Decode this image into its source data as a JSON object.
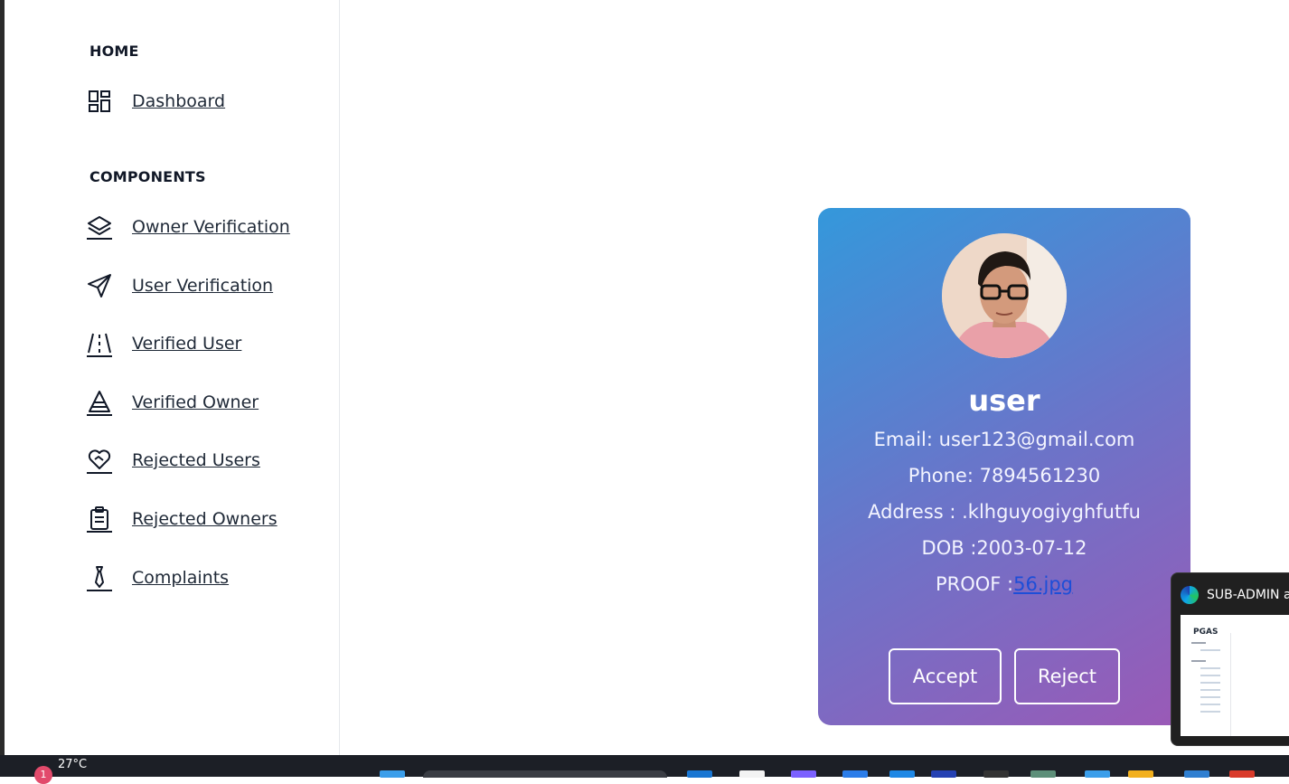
{
  "sidebar": {
    "sections": [
      {
        "title": "HOME"
      },
      {
        "title": "COMPONENTS"
      }
    ],
    "items": [
      {
        "label": "Dashboard",
        "icon": "dashboard-icon"
      },
      {
        "label": "Owner Verification",
        "icon": "layers-icon"
      },
      {
        "label": "User Verification",
        "icon": "send-icon"
      },
      {
        "label": "Verified User",
        "icon": "road-icon"
      },
      {
        "label": "Verified Owner",
        "icon": "cone-icon"
      },
      {
        "label": "Rejected Users",
        "icon": "heart-handshake-icon"
      },
      {
        "label": "Rejected Owners",
        "icon": "clipboard-icon"
      },
      {
        "label": "Complaints",
        "icon": "tie-icon"
      }
    ]
  },
  "card": {
    "name": "user",
    "email": "Email: user123@gmail.com",
    "phone": "Phone: 7894561230",
    "address": "Address : .klhguyogiyghfutfu",
    "dob": "DOB :2003-07-12",
    "proof_label": "PROOF :",
    "proof_link": "56.jpg",
    "accept_label": "Accept",
    "reject_label": "Reject",
    "gradient_start": "#3498db",
    "gradient_end": "#9b59b6"
  },
  "taskbar": {
    "weather": "27°C",
    "notification_count": "1"
  },
  "preview": {
    "title": "SUB-ADMIN a",
    "brand": "PGAS"
  }
}
